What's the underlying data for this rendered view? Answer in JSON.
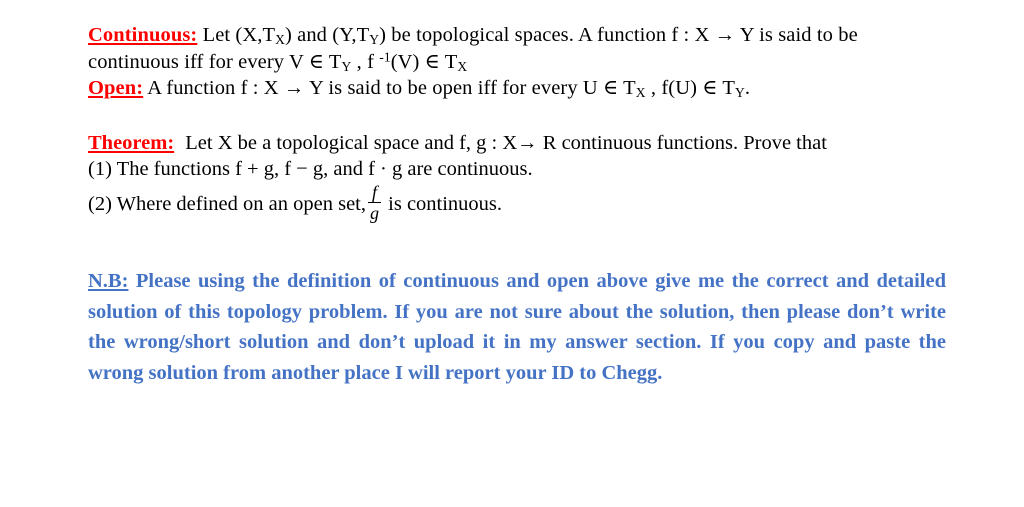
{
  "document": {
    "background_color": "#FFFFFF",
    "body_text_color": "#000000",
    "heading_color": "#FF0000",
    "note_color": "#4472C4"
  },
  "definitions": {
    "continuous": {
      "label": "Continuous:",
      "text_part_1": " Let (X,T",
      "sub_1": "X",
      "text_part_2": ") and (Y,T",
      "sub_2": "Y",
      "text_part_3": ") be topological spaces. A function f : X → Y  is said to be continuous iff for every V ∈ T",
      "sub_3": "Y",
      "text_part_4": " , f ",
      "sup_1": "-1",
      "text_part_5": "(V) ∈ T",
      "sub_4": "X"
    },
    "open": {
      "label": "Open:",
      "text_part_1": " A function f : X → Y is said to be open iff for every U ∈ T",
      "sub_1": "X",
      "text_part_2": " , f(U) ∈ T",
      "sub_2": "Y",
      "text_part_3": "."
    }
  },
  "theorem": {
    "label": "Theorem:",
    "statement": "Let X be a topological space and f, g : X→ R continuous functions. Prove that",
    "items": [
      {
        "number": "(1)",
        "text": "The functions f + g, f − g, and f · g are continuous."
      },
      {
        "number": "(2)",
        "text_before": "Where defined on an open set,",
        "fraction_numerator": "f",
        "fraction_denominator": "g",
        "text_after": "is continuous."
      }
    ]
  },
  "note": {
    "label": "N.B:",
    "text": " Please using the definition of continuous and open above give me the correct and detailed solution of this topology problem. If you are not sure about the solution, then please don’t write the wrong/short solution and don’t upload it in my answer section. If you copy and paste the wrong solution from another place I will report your ID to Chegg."
  }
}
